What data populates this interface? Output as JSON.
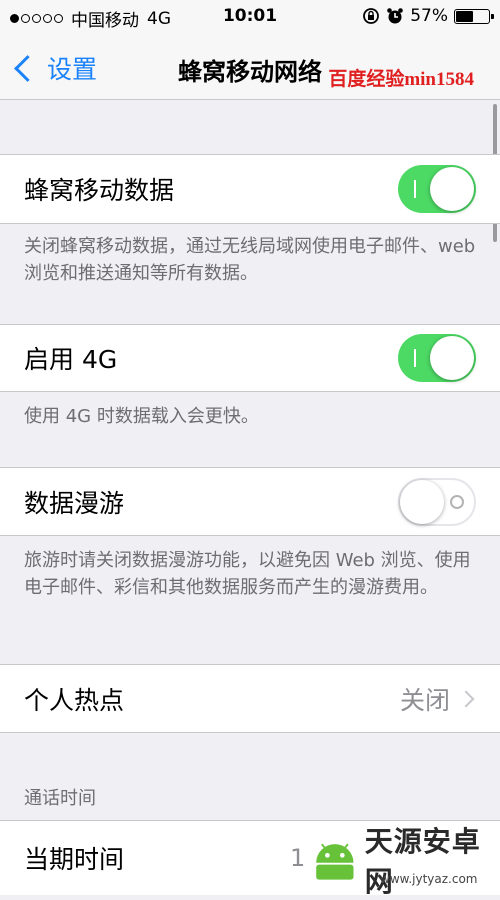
{
  "status_bar": {
    "carrier": "中国移动",
    "network": "4G",
    "time": "10:01",
    "battery_percent": "57%",
    "battery_level": 0.57
  },
  "nav": {
    "back_label": "设置",
    "title": "蜂窝移动网络"
  },
  "watermark": {
    "text": "百度经验min1584",
    "logo_text": "天源安卓网",
    "logo_url": "www.jytyaz.com"
  },
  "cells": {
    "cellular_data": {
      "label": "蜂窝移动数据",
      "enabled": true
    },
    "cellular_data_footer": "关闭蜂窝移动数据，通过无线局域网使用电子邮件、web 浏览和推送通知等所有数据。",
    "enable_4g": {
      "label": "启用 4G",
      "enabled": true
    },
    "enable_4g_footer": "使用 4G 时数据载入会更快。",
    "data_roaming": {
      "label": "数据漫游",
      "enabled": false
    },
    "data_roaming_footer": "旅游时请关闭数据漫游功能，以避免因 Web 浏览、使用电子邮件、彩信和其他数据服务而产生的漫游费用。",
    "hotspot": {
      "label": "个人热点",
      "value": "关闭"
    },
    "call_time_header": "通话时间",
    "current_period": {
      "label": "当期时间",
      "value": "1"
    }
  },
  "colors": {
    "accent": "#1a82fb",
    "toggle_on": "#4cd964",
    "background": "#efeff4",
    "watermark": "#e02020"
  },
  "icons": [
    "back-chevron-icon",
    "lock-rotation-icon",
    "alarm-icon",
    "battery-icon",
    "disclosure-chevron-icon"
  ]
}
